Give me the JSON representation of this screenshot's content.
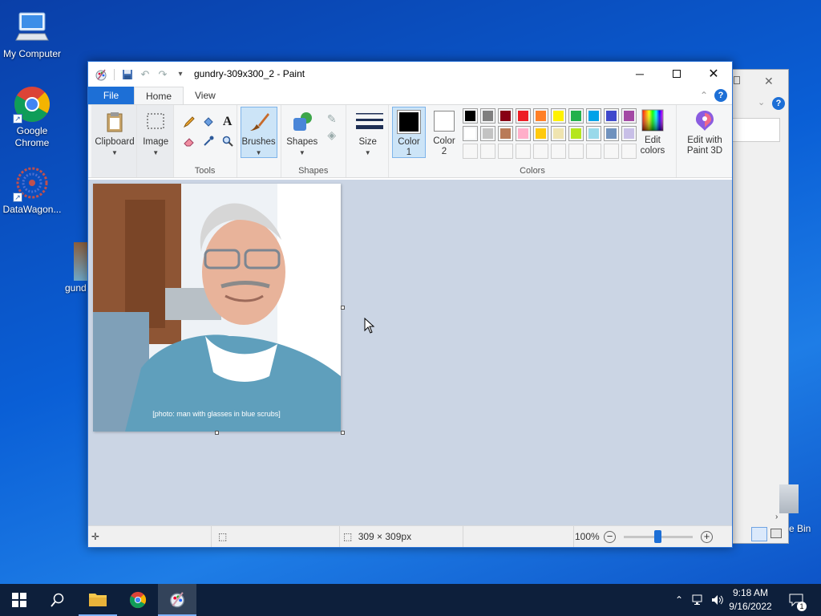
{
  "desktop": {
    "icons": [
      {
        "label": "My Computer"
      },
      {
        "label": "Google Chrome"
      },
      {
        "label": "DataWagon..."
      },
      {
        "label": "gund"
      }
    ],
    "recycle_bin_partial": "e Bin"
  },
  "paint": {
    "title": "gundry-309x300_2 - Paint",
    "tabs": {
      "file": "File",
      "home": "Home",
      "view": "View"
    },
    "ribbon": {
      "clipboard": "Clipboard",
      "image": "Image",
      "tools_group": "Tools",
      "brushes": "Brushes",
      "shapes_btn": "Shapes",
      "shapes_group": "Shapes",
      "size": "Size",
      "color1": "Color 1",
      "color2": "Color 2",
      "edit_colors": "Edit colors",
      "edit_paint3d": "Edit with Paint 3D",
      "colors_group": "Colors"
    },
    "palette": {
      "row1": [
        "#000000",
        "#7f7f7f",
        "#880015",
        "#ed1c24",
        "#ff7f27",
        "#fff200",
        "#22b14c",
        "#00a2e8",
        "#3f48cc",
        "#a349a4"
      ],
      "row2": [
        "#ffffff",
        "#c3c3c3",
        "#b97a57",
        "#ffaec9",
        "#ffc90e",
        "#efe4b0",
        "#b5e61d",
        "#99d9ea",
        "#7092be",
        "#c8bfe7"
      ]
    },
    "color1_value": "#000000",
    "color2_value": "#ffffff",
    "canvas_image_label": "[photo: man with glasses in blue scrubs]",
    "status": {
      "dimensions": "309 × 309px",
      "zoom": "100%"
    }
  },
  "taskbar": {
    "time": "9:18 AM",
    "date": "9/16/2022",
    "notification_count": "1"
  }
}
